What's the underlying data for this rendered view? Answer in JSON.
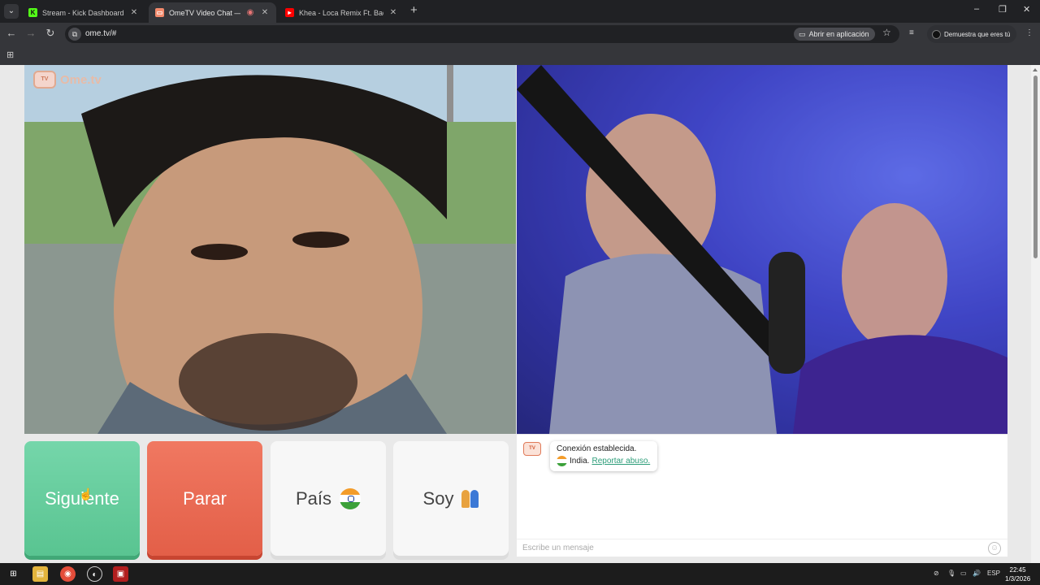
{
  "browser": {
    "tabs": [
      {
        "title": "Stream - Kick Dashboard",
        "favicon": "kick-icon",
        "active": false
      },
      {
        "title": "OmeTV Video Chat — Ome",
        "favicon": "ometv-icon",
        "active": true
      },
      {
        "title": "Khea - Loca Remix Ft. Bad Bunn",
        "favicon": "youtube-icon",
        "active": false
      }
    ],
    "new_tab": "+",
    "url": "ome.tv/#",
    "open_app_label": "Abrir en aplicación",
    "profile_label": "Demuestra que eres tú",
    "window_controls": [
      "–",
      "❐",
      "✕"
    ]
  },
  "page": {
    "logo_text": "Ome.tv",
    "buttons": {
      "next": "Siguiente",
      "stop": "Parar",
      "country": "País",
      "gender": "Soy"
    },
    "chat": {
      "status": "Conexión establecida.",
      "country": "India.",
      "report": "Reportar abuso.",
      "placeholder": "Escribe un mensaje"
    }
  },
  "taskbar": {
    "language": "ESP",
    "time": "22:45",
    "date": "1/3/2026"
  },
  "colors": {
    "next": "#66cc9c",
    "stop": "#e86a53",
    "accent_link": "#2d9d79"
  }
}
